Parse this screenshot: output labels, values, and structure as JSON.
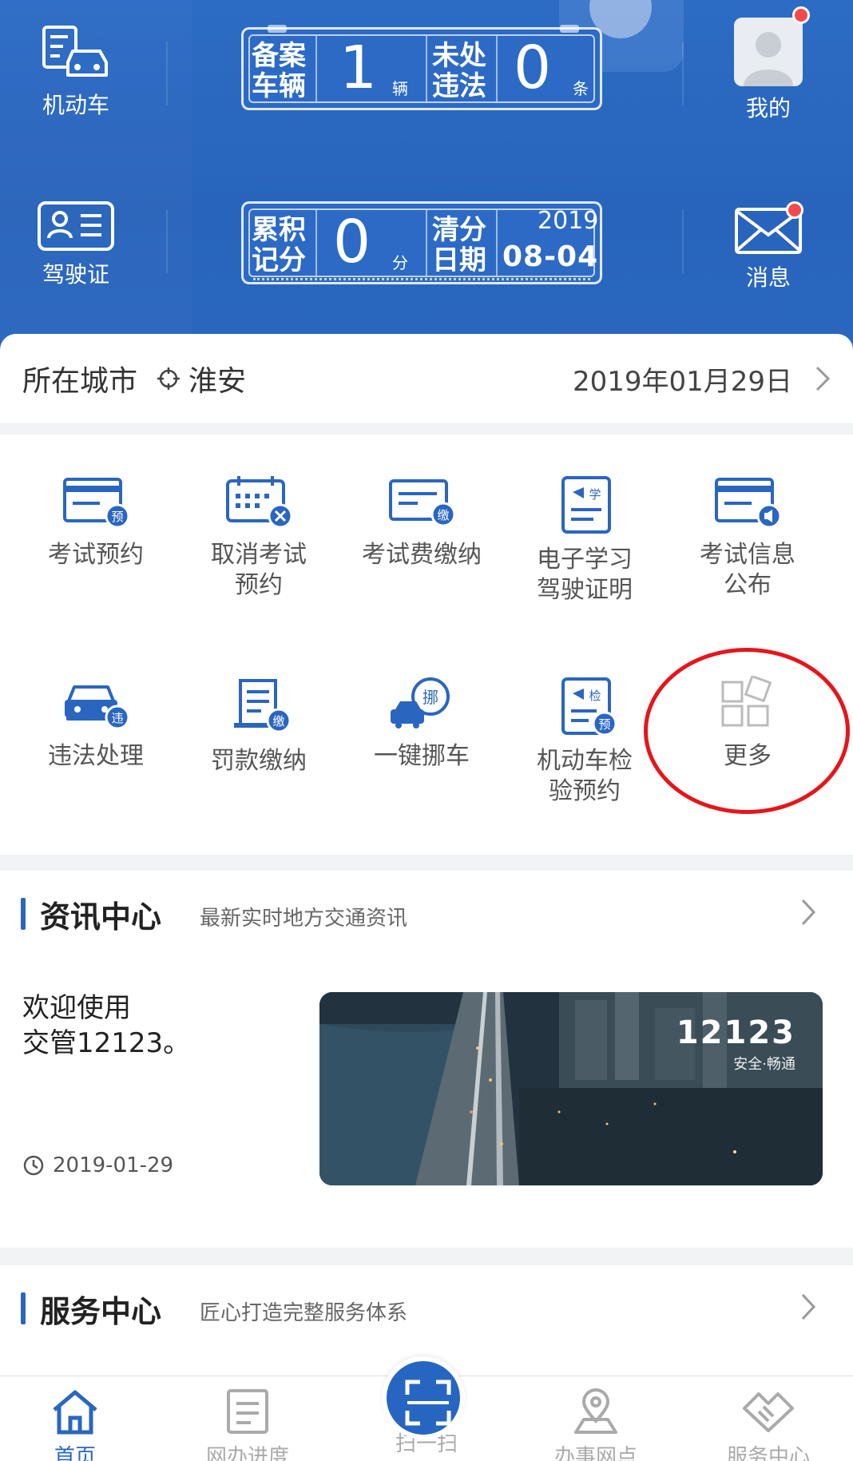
{
  "header": {
    "vehicle_label": "机动车",
    "license_label": "驾驶证",
    "mine_label": "我的",
    "message_label": "消息",
    "plate1": {
      "left_label_1": "备案",
      "left_label_2": "车辆",
      "count": "1",
      "count_unit": "辆",
      "right_label_1": "未处",
      "right_label_2": "违法",
      "violations": "0",
      "violations_unit": "条"
    },
    "plate2": {
      "left_label_1": "累积",
      "left_label_2": "记分",
      "points": "0",
      "points_unit": "分",
      "right_label_1": "清分",
      "right_label_2": "日期",
      "year": "2019",
      "date": "08-04"
    }
  },
  "city": {
    "label": "所在城市",
    "name": "淮安",
    "date": "2019年01月29日"
  },
  "services": [
    {
      "line1": "考试预约",
      "line2": "",
      "badge": "预"
    },
    {
      "line1": "取消考试",
      "line2": "预约",
      "badge": "×"
    },
    {
      "line1": "考试费缴纳",
      "line2": "",
      "badge": "缴"
    },
    {
      "line1": "电子学习",
      "line2": "驾驶证明",
      "badge": "学"
    },
    {
      "line1": "考试信息",
      "line2": "公布",
      "badge": "◀"
    },
    {
      "line1": "违法处理",
      "line2": "",
      "badge": "违"
    },
    {
      "line1": "罚款缴纳",
      "line2": "",
      "badge": "缴"
    },
    {
      "line1": "一键挪车",
      "line2": "",
      "badge": "挪"
    },
    {
      "line1": "机动车检",
      "line2": "验预约",
      "badge": "预",
      "badge2": "检"
    },
    {
      "line1": "更多",
      "line2": ""
    }
  ],
  "news": {
    "title": "资讯中心",
    "subtitle": "最新实时地方交通资讯",
    "headline_1": "欢迎使用",
    "headline_2": "交管12123。",
    "date": "2019-01-29",
    "image_brand": "12123",
    "image_tagline": "安全·畅通"
  },
  "service_center": {
    "title": "服务中心",
    "subtitle": "匠心打造完整服务体系"
  },
  "bottom_nav": [
    {
      "label": "首页"
    },
    {
      "label": "网办进度"
    },
    {
      "label": "扫一扫"
    },
    {
      "label": "办事网点"
    },
    {
      "label": "服务中心"
    }
  ],
  "colors": {
    "primary": "#2a66c0",
    "header_bg": "#2d6cc4",
    "badge": "#2a66c0",
    "highlight": "#e5161b"
  }
}
